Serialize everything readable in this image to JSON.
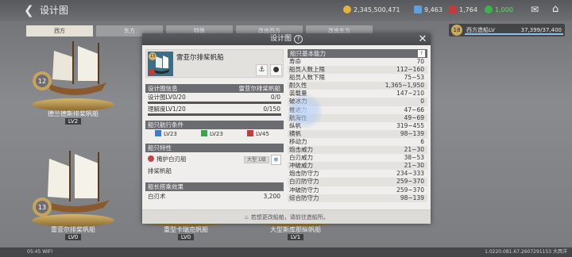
{
  "topbar": {
    "title": "设计图",
    "resources": {
      "gold": "2,345,500,471",
      "blue": "9,463",
      "red": "1,764",
      "green": "1,000"
    }
  },
  "tabs": [
    "西方",
    "东方",
    "特殊",
    "改良西方",
    "改良东方"
  ],
  "shipyard": {
    "label": "西方造船LV",
    "level": "18",
    "exp": "37,399/37,400",
    "progress": 0.9999
  },
  "cards": [
    {
      "name": "德兰德斯排桨帆船",
      "level": "LV2",
      "medal": "12"
    },
    {
      "name": "雷亚尔排桨帆船",
      "level": "LV0",
      "medal": "13"
    },
    {
      "name": "重型卡瑞克帆船",
      "level": "LV0",
      "medal": ""
    },
    {
      "name": "大型斯库那纵帆船",
      "level": "LV1",
      "medal": ""
    }
  ],
  "modal": {
    "title": "设计图",
    "ship": {
      "name": "雷亚尔排桨帆船",
      "badge": "13"
    },
    "design_info": {
      "header": "设计图信息",
      "header_value": "雷亚尔排桨帆船",
      "lv_label": "设计图LV0/20",
      "lv_value": "0/0",
      "understand_label": "理解度LV1/20",
      "understand_value": "0/150"
    },
    "sail_cond": {
      "header": "船只航行条件",
      "items": [
        {
          "label": "LV23",
          "color": "#3c7ccc"
        },
        {
          "label": "LV23",
          "color": "#3aa54a"
        },
        {
          "label": "LV45",
          "color": "#c93a3a"
        }
      ]
    },
    "traits": {
      "header": "船只特性",
      "skill": "掩护白刃船",
      "chip": "大型 1级",
      "sub": "排桨帆船"
    },
    "captain": {
      "header": "船长搭乘效果",
      "label": "白刃术",
      "value": "3,200"
    },
    "basic": {
      "header": "船只基本能力",
      "stats": [
        {
          "label": "寿命",
          "value": "70"
        },
        {
          "label": "船员人数上限",
          "value": "112~160"
        },
        {
          "label": "船员人数下限",
          "value": "75~53"
        },
        {
          "label": "耐久性",
          "value": "1,365~1,950"
        },
        {
          "label": "装载量",
          "value": "147~210"
        },
        {
          "label": "破冰力",
          "value": "0"
        },
        {
          "label": "推进力",
          "value": "47~66"
        },
        {
          "label": "航海性",
          "value": "49~69"
        },
        {
          "label": "纵帆",
          "value": "319~455"
        },
        {
          "label": "横帆",
          "value": "98~139"
        },
        {
          "label": "移动力",
          "value": "6"
        },
        {
          "label": "炮击威力",
          "value": "21~30"
        },
        {
          "label": "白刃威力",
          "value": "38~53"
        },
        {
          "label": "冲破威力",
          "value": "21~30"
        },
        {
          "label": "炮击防守力",
          "value": "234~333"
        },
        {
          "label": "白刃防守力",
          "value": "259~370"
        },
        {
          "label": "冲破防守力",
          "value": "259~370"
        },
        {
          "label": "综合防守力",
          "value": "98~139"
        }
      ]
    },
    "footer": "若想更改船舶，请前往造船所。"
  },
  "bottombar": {
    "time": "05:45",
    "net": "WIFI",
    "version": "1.0220.081.67.2607291153 大西洋"
  }
}
